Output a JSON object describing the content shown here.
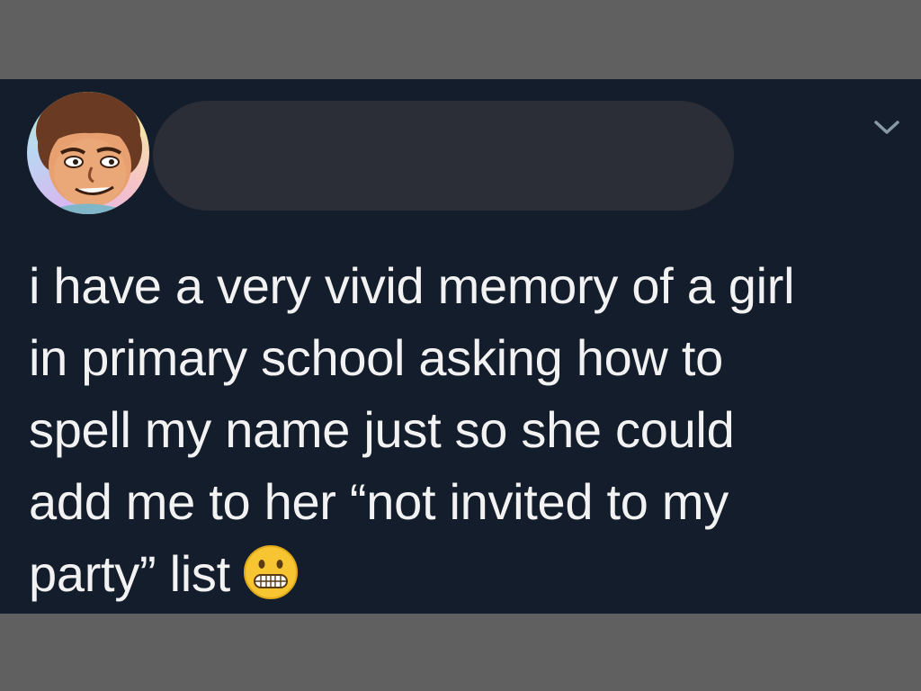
{
  "tweet": {
    "text_lines": [
      "i have a very vivid memory of a girl",
      "in primary school asking how to",
      "spell my name just so she could",
      "add me to her “not invited to my",
      "party” list"
    ],
    "emoji": "grimacing-face",
    "author_name_redacted": true
  },
  "icons": {
    "caret": "chevron-down-icon",
    "avatar": "cartoon-face-avatar"
  },
  "colors": {
    "background": "#606060",
    "card": "#141d2b",
    "text": "#f2f2f2",
    "redaction": "#2b2e36",
    "caret": "#8899a6"
  }
}
